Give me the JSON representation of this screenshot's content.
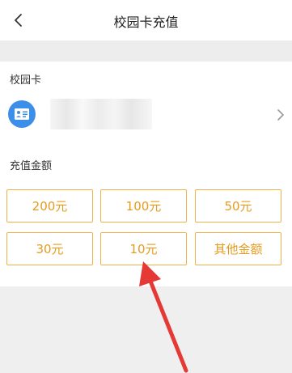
{
  "header": {
    "title": "校园卡充值",
    "back_icon": "chevron-left-icon"
  },
  "card_section": {
    "label": "校园卡",
    "card_icon": "id-card-icon",
    "card_icon_color": "#3c8fe8",
    "chevron_icon": "chevron-right-icon"
  },
  "amount_section": {
    "label": "充值金额",
    "accent_color": "#e79b1e",
    "options": [
      "200元",
      "100元",
      "50元",
      "30元",
      "10元",
      "其他金额"
    ]
  },
  "annotation": {
    "arrow_color": "#e53935",
    "arrow_icon": "red-arrow-icon"
  }
}
